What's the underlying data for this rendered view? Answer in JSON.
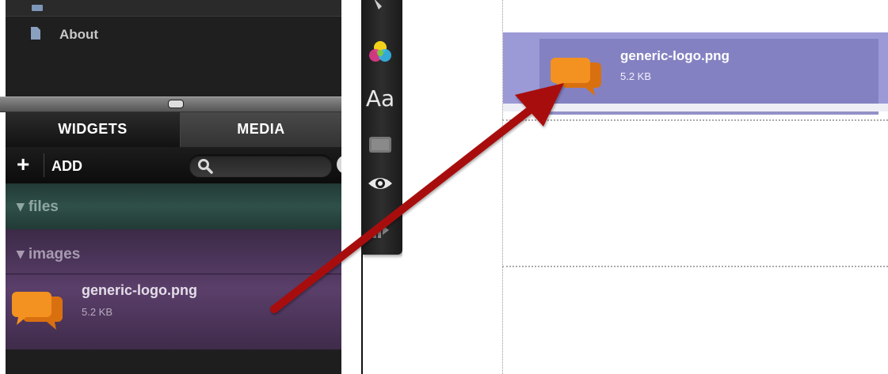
{
  "pages": {
    "items": [
      {
        "label": "About"
      }
    ]
  },
  "tabs": {
    "widgets": "WIDGETS",
    "media": "MEDIA"
  },
  "toolbar": {
    "add_label": "ADD",
    "add_symbol": "+",
    "search_placeholder": ""
  },
  "sections": {
    "files": "▾ files",
    "images": "▾ images"
  },
  "media_item": {
    "filename": "generic-logo.png",
    "size": "5.2 KB"
  },
  "vertical_tools": {
    "font_label": "Aa"
  },
  "colors": {
    "images_bg": "#5a3f6a",
    "files_bg": "#2f5049",
    "drop_highlight": "#9c9ad6",
    "arrow": "#b00c0c",
    "logo": "#f08a1c"
  }
}
